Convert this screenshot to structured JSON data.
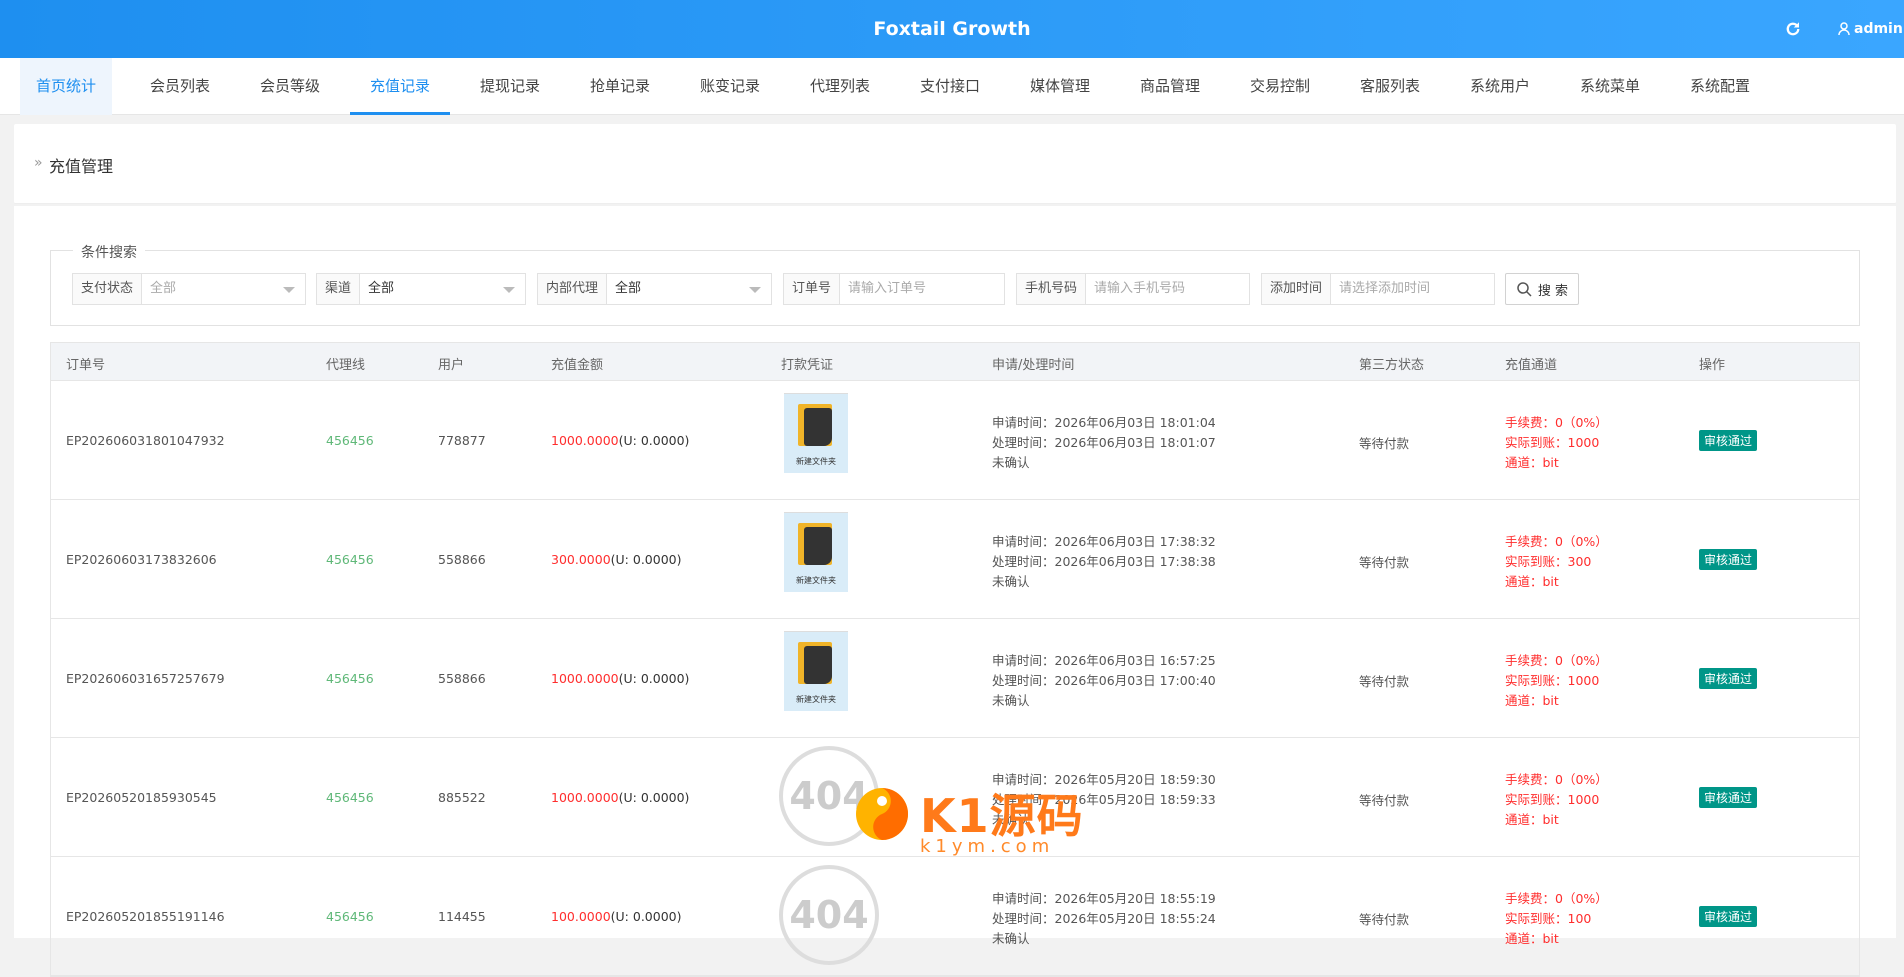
{
  "header": {
    "title": "Foxtail Growth",
    "user": "admin",
    "refresh_icon": "refresh-icon",
    "user_icon": "user-icon"
  },
  "nav": {
    "tabs": [
      {
        "label": "首页统计"
      },
      {
        "label": "会员列表"
      },
      {
        "label": "会员等级"
      },
      {
        "label": "充值记录"
      },
      {
        "label": "提现记录"
      },
      {
        "label": "抢单记录"
      },
      {
        "label": "账变记录"
      },
      {
        "label": "代理列表"
      },
      {
        "label": "支付接口"
      },
      {
        "label": "媒体管理"
      },
      {
        "label": "商品管理"
      },
      {
        "label": "交易控制"
      },
      {
        "label": "客服列表"
      },
      {
        "label": "系统用户"
      },
      {
        "label": "系统菜单"
      },
      {
        "label": "系统配置"
      }
    ],
    "active": "充值记录"
  },
  "page": {
    "title": "充值管理"
  },
  "search": {
    "legend": "条件搜索",
    "pay_status": {
      "label": "支付状态",
      "value": "全部"
    },
    "channel": {
      "label": "渠道",
      "value": "全部"
    },
    "agent": {
      "label": "内部代理",
      "value": "全部"
    },
    "order": {
      "label": "订单号",
      "placeholder": "请输入订单号"
    },
    "phone": {
      "label": "手机号码",
      "placeholder": "请输入手机号码"
    },
    "add_time": {
      "label": "添加时间",
      "placeholder": "请选择添加时间"
    },
    "button": "搜 索"
  },
  "table": {
    "headers": [
      "订单号",
      "代理线",
      "用户",
      "充值金额",
      "打款凭证",
      "申请/处理时间",
      "第三方状态",
      "充值通道",
      "操作"
    ],
    "rows": [
      {
        "order": "EP202606031801047932",
        "agent": "456456",
        "user": "778877",
        "amount": "1000.0000",
        "usdt": "(U: 0.0000)",
        "proof": "folder",
        "proof_caption": "新建文件夹",
        "apply": "申请时间：2026年06月03日 18:01:04",
        "process": "处理时间：2026年06月03日 18:01:07",
        "confirm": "未确认",
        "status": "等待付款",
        "fee": "手续费：0（0%）",
        "actual": "实际到账：1000",
        "chan": "通道：bit",
        "op": "审核通过"
      },
      {
        "order": "EP202606031738326​06",
        "agent": "456456",
        "user": "558866",
        "amount": "300.0000",
        "usdt": "(U: 0.0000)",
        "proof": "folder",
        "proof_caption": "新建文件夹",
        "apply": "申请时间：2026年06月03日 17:38:32",
        "process": "处理时间：2026年06月03日 17:38:38",
        "confirm": "未确认",
        "status": "等待付款",
        "fee": "手续费：0（0%）",
        "actual": "实际到账：300",
        "chan": "通道：bit",
        "op": "审核通过"
      },
      {
        "order": "EP202606031657257679",
        "agent": "456456",
        "user": "558866",
        "amount": "1000.0000",
        "usdt": "(U: 0.0000)",
        "proof": "folder",
        "proof_caption": "新建文件夹",
        "apply": "申请时间：2026年06月03日 16:57:25",
        "process": "处理时间：2026年06月03日 17:00:40",
        "confirm": "未确认",
        "status": "等待付款",
        "fee": "手续费：0（0%）",
        "actual": "实际到账：1000",
        "chan": "通道：bit",
        "op": "审核通过"
      },
      {
        "order": "EP202605201859305​45",
        "agent": "456456",
        "user": "885522",
        "amount": "1000.0000",
        "usdt": "(U: 0.0000)",
        "proof": "404",
        "proof_caption": "404",
        "apply": "申请时间：2026年05月20日 18:59:30",
        "process": "处理时间：2026年05月20日 18:59:33",
        "confirm": "未确认",
        "status": "等待付款",
        "fee": "手续费：0（0%）",
        "actual": "实际到账：1000",
        "chan": "通道：bit",
        "op": "审核通过"
      },
      {
        "order": "EP202605201855191146",
        "agent": "456456",
        "user": "114455",
        "amount": "100.0000",
        "usdt": "(U: 0.0000)",
        "proof": "404",
        "proof_caption": "404",
        "apply": "申请时间：2026年05月20日 18:55:19",
        "process": "处理时间：2026年05月20日 18:55:24",
        "confirm": "未确认",
        "status": "等待付款",
        "fee": "手续费：0（0%）",
        "actual": "实际到账：100",
        "chan": "通道：bit",
        "op": "审核通过"
      }
    ]
  },
  "watermark": {
    "brand": "K1源码",
    "domain": "k1ym.com"
  },
  "colors": {
    "primary": "#1e8ff0",
    "agent_green": "#5fb878",
    "amount_red": "#ff2d2d",
    "approve": "#009688"
  }
}
